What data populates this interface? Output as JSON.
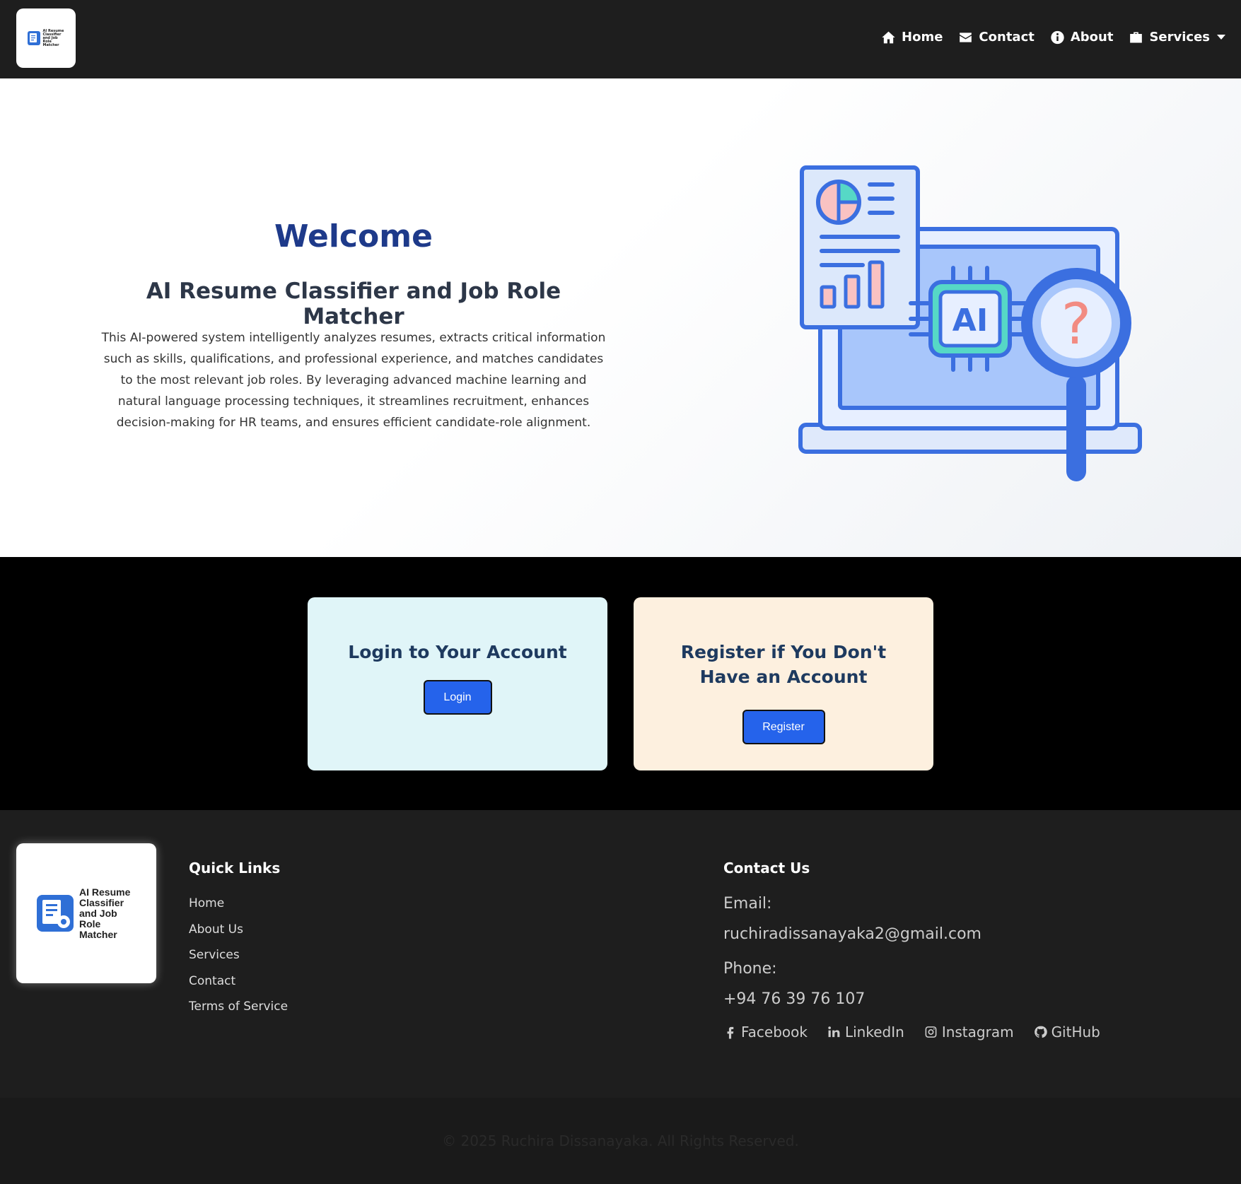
{
  "nav": {
    "logo_text": "AI Resume Classifier and Job Role Matcher",
    "links": [
      {
        "label": "Home",
        "icon": "home-icon"
      },
      {
        "label": "Contact",
        "icon": "envelope-icon"
      },
      {
        "label": "About",
        "icon": "info-icon"
      },
      {
        "label": "Services",
        "icon": "briefcase-icon"
      }
    ]
  },
  "hero": {
    "title": "Welcome",
    "subtitle": "AI Resume Classifier and Job Role Matcher",
    "description": "This AI-powered system intelligently analyzes resumes, extracts critical information such as skills, qualifications, and professional experience, and matches candidates to the most relevant job roles. By leveraging advanced machine learning and natural language processing techniques, it streamlines recruitment, enhances decision-making for HR teams, and ensures efficient candidate-role alignment.",
    "illustration_chip_text": "AI",
    "illustration_question": "?"
  },
  "auth": {
    "login_title": "Login to Your Account",
    "login_button": "Login",
    "register_title": "Register if You Don't Have an Account",
    "register_button": "Register"
  },
  "footer": {
    "logo_text": "AI Resume Classifier and Job Role Matcher",
    "quick_links_heading": "Quick Links",
    "quick_links": [
      "Home",
      "About Us",
      "Services",
      "Contact",
      "Terms of Service"
    ],
    "contact_heading": "Contact Us",
    "email_label": "Email:",
    "email": "ruchiradissanayaka2@gmail.com",
    "phone_label": "Phone:",
    "phone": "+94 76 39 76 107",
    "socials": [
      {
        "label": "Facebook",
        "icon": "facebook-icon"
      },
      {
        "label": "LinkedIn",
        "icon": "linkedin-icon"
      },
      {
        "label": "Instagram",
        "icon": "instagram-icon"
      },
      {
        "label": "GitHub",
        "icon": "github-icon"
      }
    ]
  },
  "copyright": "© 2025 Ruchira Dissanayaka. All Rights Reserved.",
  "colors": {
    "navbar_bg": "#1e1e1e",
    "primary_heading": "#1e3a8a",
    "button_blue": "#2563eb",
    "login_card_bg": "#e0f5f8",
    "register_card_bg": "#fdf0df"
  }
}
